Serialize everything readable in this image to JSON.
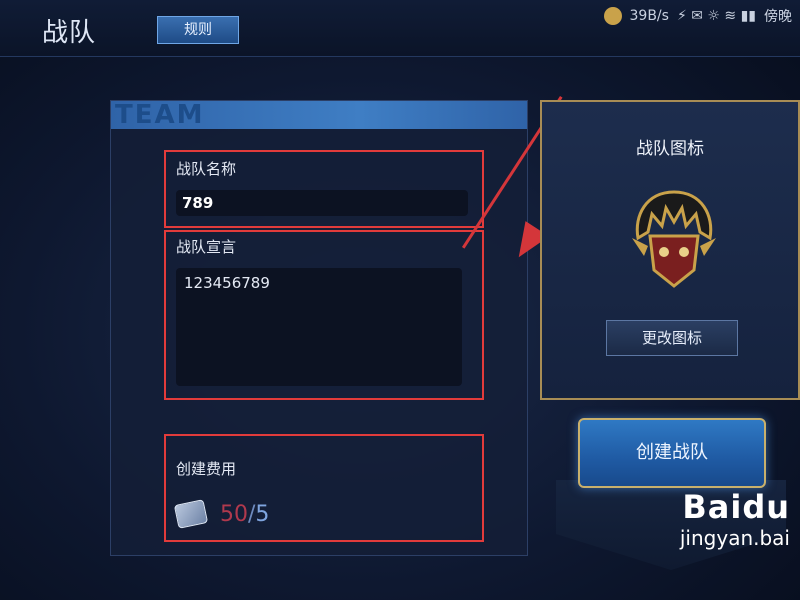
{
  "header": {
    "title": "战队",
    "rules_tab": "规则",
    "status_text": "39B/s",
    "status_tail": "傍晚"
  },
  "panel": {
    "team_label": "TEAM"
  },
  "form": {
    "name_label": "战队名称",
    "name_value": "789",
    "declaration_label": "战队宣言",
    "declaration_value": "123456789",
    "fee_label": "创建费用",
    "fee_have": "50",
    "fee_sep": "/",
    "fee_need": "5"
  },
  "icon_panel": {
    "title": "战队图标",
    "change_button": "更改图标"
  },
  "actions": {
    "create_button": "创建战队"
  },
  "watermark": {
    "logo": "Baidu",
    "sub": "jingyan.bai"
  },
  "colors": {
    "highlight": "#e23b3b",
    "accent": "#2f79c4",
    "gold": "#a88d55"
  }
}
